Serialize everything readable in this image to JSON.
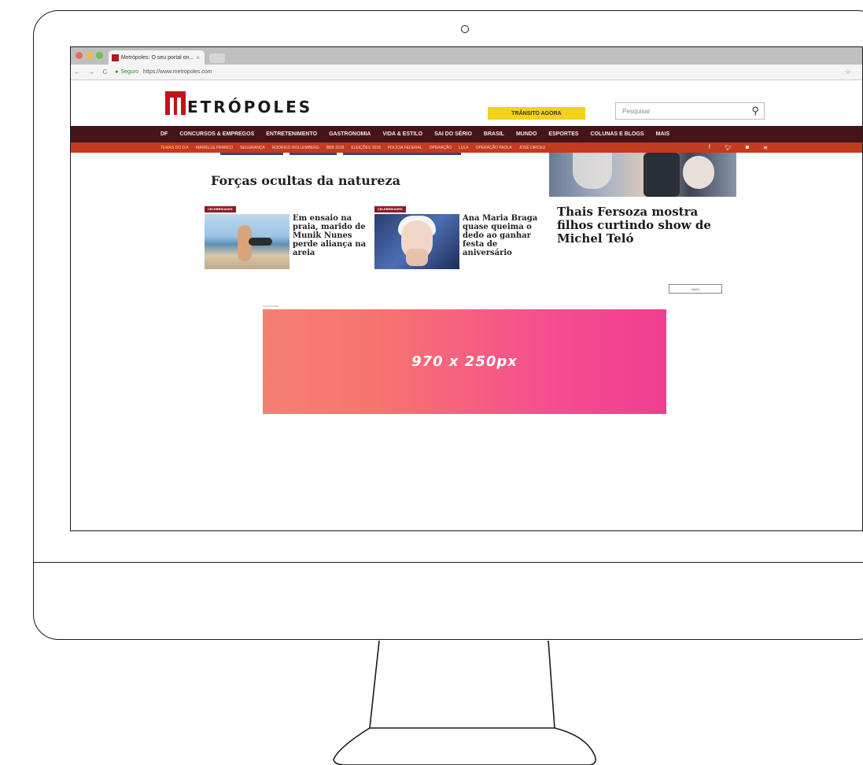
{
  "browser": {
    "tab_title": "Metrópoles: O seu portal on...",
    "tab_close": "×",
    "nav_glyphs": "← → C",
    "secure_label": "Seguro",
    "url": "https://www.metropoles.com",
    "star": "☆"
  },
  "site": {
    "logo_text": "ETRÓPOLES",
    "traffic_button": "TRÂNSITO AGORA",
    "search_placeholder": "Pesquisar",
    "main_nav": [
      "DF",
      "CONCURSOS & EMPREGOS",
      "ENTRETENIMENTO",
      "GASTRONOMIA",
      "VIDA & ESTILO",
      "SAI DO SÉRIO",
      "BRASIL",
      "MUNDO",
      "ESPORTES",
      "COLUNAS E BLOGS",
      "MAIS"
    ],
    "sub_nav_label": "TEMAS DO DIA",
    "sub_nav": [
      "MARIELLE FRANCO",
      "SEGURANÇA",
      "RODRIGO ROLLEMBERG",
      "BBB 2018",
      "ELEIÇÕES 2018",
      "POLÍCIA FEDERAL",
      "OPERAÇÃO",
      "LULA",
      "OPERAÇÃO PAOLA",
      "JOSÉ DIRCEU"
    ],
    "social": [
      "f",
      "t",
      "ig",
      "rss"
    ]
  },
  "content": {
    "section_title": "Forças ocultas da natureza",
    "cards": [
      {
        "tag": "CELEBRIDADES",
        "headline": "Em ensaio na praia, marido de Munik Nunes perde aliança na areia"
      },
      {
        "tag": "CELEBRIDADES",
        "headline": "Ana Maria Braga quase queima o dedo ao ganhar festa de aniversário"
      }
    ],
    "big_headline": "Thais Fersoza mostra filhos curtindo show de Michel Teló",
    "more_button": "MAIS",
    "ad_label": "PUBLICIDADE",
    "ad_text": "970 x 250px"
  },
  "colors": {
    "brand_red": "#c0141b",
    "nav_dark": "#431518",
    "subnav_orange": "#c33a1e",
    "traffic_yellow": "#f2d21c"
  }
}
